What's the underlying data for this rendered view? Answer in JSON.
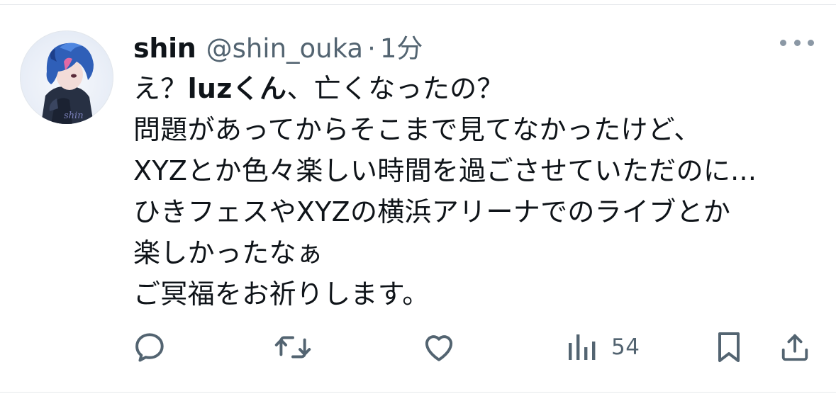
{
  "tweet": {
    "author": {
      "display_name": "shin",
      "handle": "@shin_ouka",
      "separator": "·",
      "time": "1分",
      "avatar_signature": "shin"
    },
    "text_lines": [
      {
        "before": "え？",
        "bold": "luzくん",
        "after": "、亡くなったの？"
      },
      {
        "before": "問題があってからそこまで見てなかったけど、",
        "bold": "",
        "after": ""
      },
      {
        "before": "XYZとか色々楽しい時間を過ごさせていただのに...",
        "bold": "",
        "after": ""
      },
      {
        "before": "ひきフェスやXYZの横浜アリーナでのライブとか",
        "bold": "",
        "after": ""
      },
      {
        "before": "楽しかったなぁ",
        "bold": "",
        "after": ""
      },
      {
        "before": "ご冥福をお祈りします。",
        "bold": "",
        "after": ""
      }
    ],
    "actions": {
      "reply_icon": "reply-icon",
      "retweet_icon": "retweet-icon",
      "like_icon": "heart-icon",
      "views_icon": "views-chart-icon",
      "views_count": "54",
      "bookmark_icon": "bookmark-icon",
      "share_icon": "share-icon"
    },
    "colors": {
      "text": "#0f1419",
      "secondary": "#536471",
      "divider": "#e6e9ec"
    }
  }
}
